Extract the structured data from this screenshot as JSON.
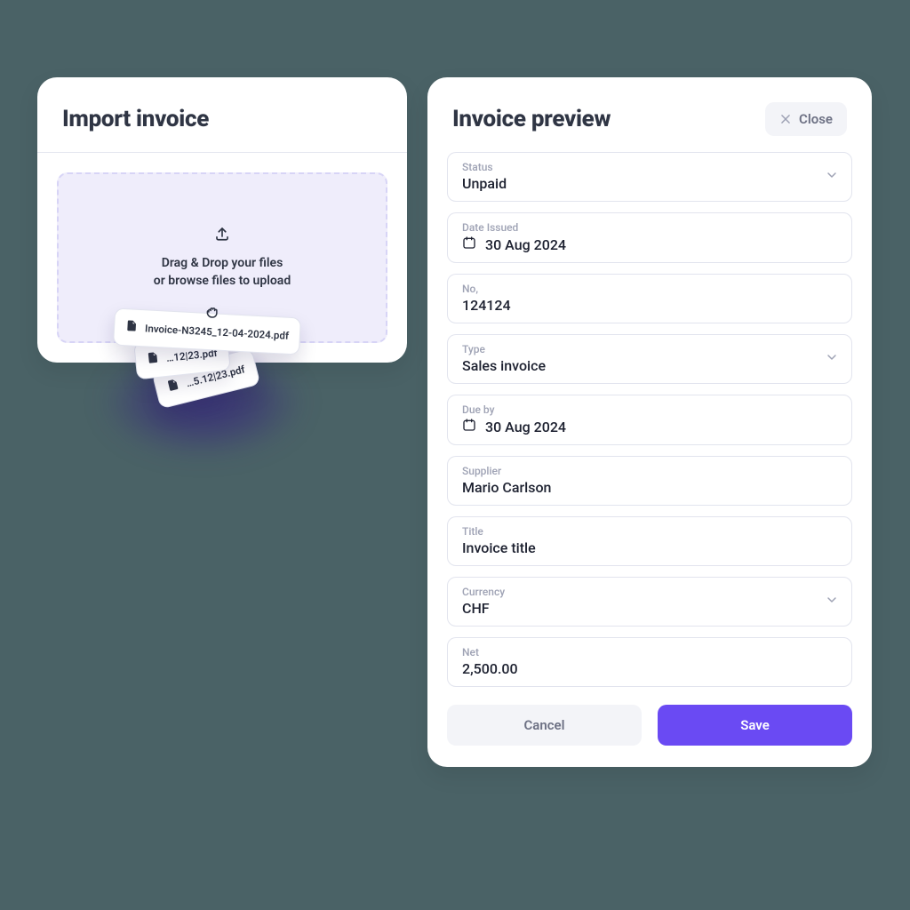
{
  "import": {
    "title": "Import invoice",
    "drop_line1": "Drag & Drop your files",
    "drop_line2": "or browse files to upload",
    "files": [
      "Invoice-N3245_12-04-2024.pdf",
      "…12|23.pdf",
      "…5.12|23.pdf"
    ]
  },
  "preview": {
    "title": "Invoice preview",
    "close_label": "Close",
    "fields": {
      "status": {
        "label": "Status",
        "value": "Unpaid"
      },
      "date_issued": {
        "label": "Date Issued",
        "value": "30 Aug 2024"
      },
      "no": {
        "label": "No,",
        "value": "124124"
      },
      "type": {
        "label": "Type",
        "value": "Sales invoice"
      },
      "due_by": {
        "label": "Due by",
        "value": "30 Aug 2024"
      },
      "supplier": {
        "label": "Supplier",
        "value": "Mario Carlson"
      },
      "title": {
        "label": "Title",
        "value": "Invoice title"
      },
      "currency": {
        "label": "Currency",
        "value": "CHF"
      },
      "net": {
        "label": "Net",
        "value": "2,500.00"
      }
    },
    "actions": {
      "cancel": "Cancel",
      "save": "Save"
    }
  },
  "colors": {
    "accent": "#6a4af3",
    "dropzone_bg": "#efedfb"
  }
}
